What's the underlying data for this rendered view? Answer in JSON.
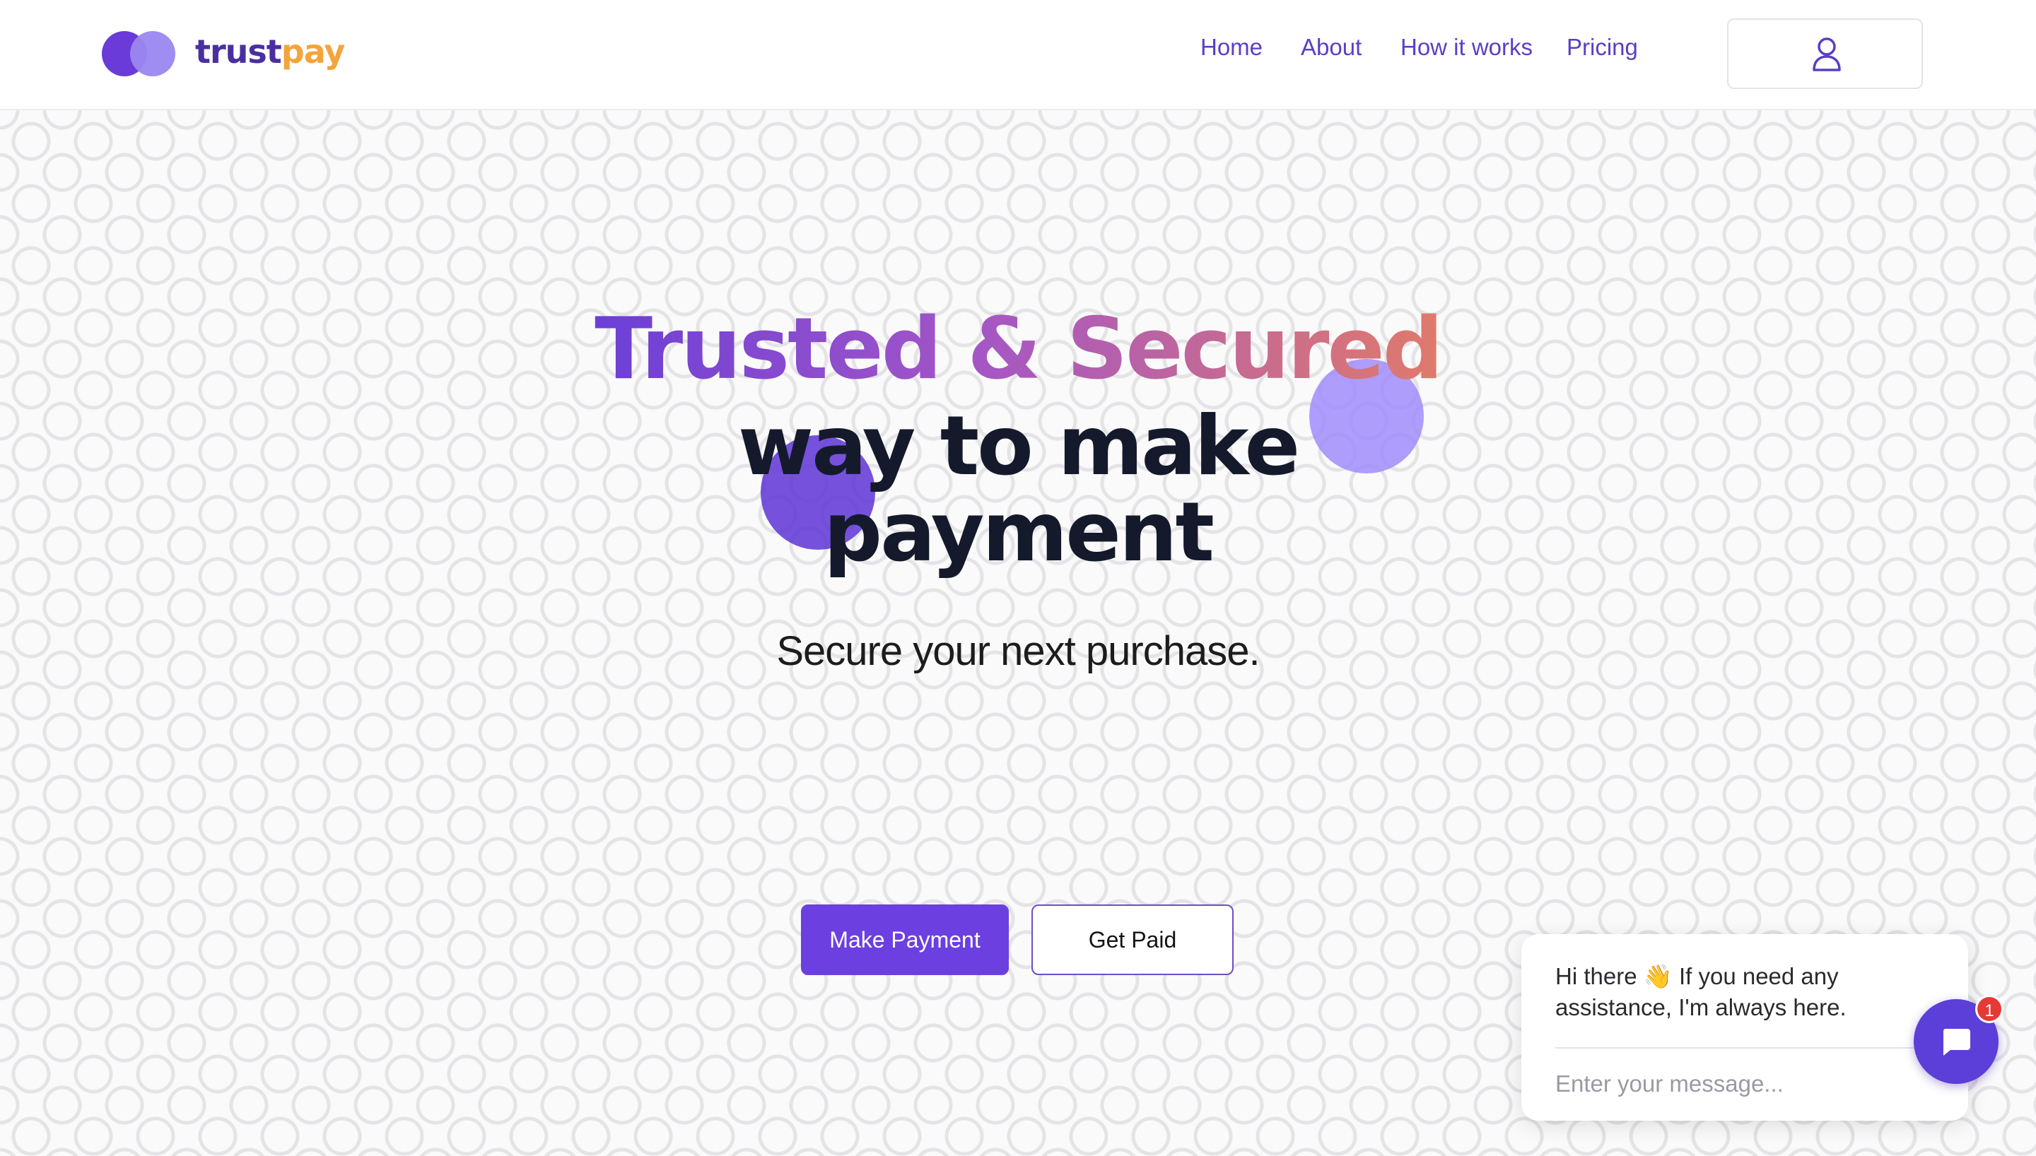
{
  "brand": {
    "name_part1": "trust",
    "name_part2": "pay"
  },
  "nav": {
    "items": [
      {
        "label": "Home"
      },
      {
        "label": "About"
      },
      {
        "label": "How it works"
      },
      {
        "label": "Pricing"
      }
    ],
    "account_icon": "user-icon"
  },
  "hero": {
    "title_gradient": "Trusted & Secured",
    "title_line2": "way to make",
    "title_line3": "payment",
    "tagline": "Secure your next purchase."
  },
  "actions": {
    "primary_label": "Make Payment",
    "secondary_label": "Get Paid"
  },
  "chat": {
    "greeting": "Hi there 👋 If you need any assistance, I'm always here.",
    "input_placeholder": "Enter your message...",
    "unread_count": "1",
    "launcher_icon": "chat-bubble-icon"
  },
  "colors": {
    "brand_primary": "#6c3fe0",
    "brand_dark": "#4a2fa0",
    "brand_accent": "#f3a43a",
    "nav_text": "#5b3fc4",
    "badge": "#e53935"
  }
}
